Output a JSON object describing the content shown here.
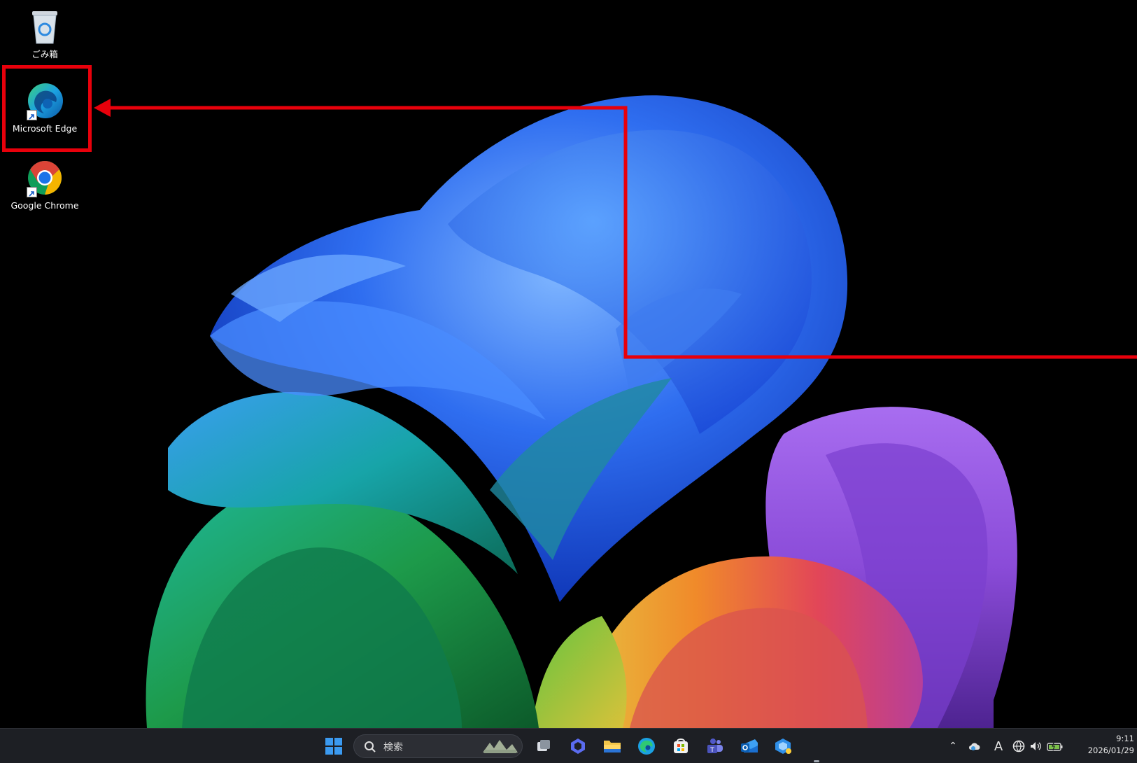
{
  "desktop": {
    "icons": [
      {
        "name": "recycle-bin",
        "label": "ごみ箱"
      },
      {
        "name": "microsoft-edge",
        "label": "Microsoft Edge"
      },
      {
        "name": "google-chrome",
        "label": "Google Chrome"
      }
    ]
  },
  "annotation": {
    "color": "#e8000b",
    "target": "microsoft-edge"
  },
  "taskbar": {
    "search_placeholder": "検索",
    "pinned": [
      "start-icon",
      "task-view-icon",
      "copilot-icon",
      "file-explorer-icon",
      "edge-icon",
      "store-icon",
      "teams-icon",
      "outlook-icon",
      "app-icon"
    ],
    "tray": {
      "ime_label": "A",
      "time": "9:11",
      "date": "2026/01/29"
    }
  },
  "colors": {
    "taskbar_bg": "#1d1f24",
    "desktop_bg": "#000000",
    "accent": "#0078d4"
  }
}
